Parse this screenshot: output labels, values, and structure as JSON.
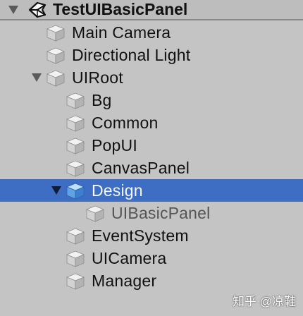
{
  "scene": {
    "name": "TestUIBasicPanel",
    "expanded": true,
    "icon": "unity-logo-icon"
  },
  "hierarchy": [
    {
      "label": "Main Camera",
      "depth": 0,
      "expandable": false,
      "selected": false
    },
    {
      "label": "Directional Light",
      "depth": 0,
      "expandable": false,
      "selected": false
    },
    {
      "label": "UIRoot",
      "depth": 0,
      "expandable": true,
      "expanded": true,
      "selected": false
    },
    {
      "label": "Bg",
      "depth": 1,
      "expandable": false,
      "selected": false
    },
    {
      "label": "Common",
      "depth": 1,
      "expandable": false,
      "selected": false
    },
    {
      "label": "PopUI",
      "depth": 1,
      "expandable": false,
      "selected": false
    },
    {
      "label": "CanvasPanel",
      "depth": 1,
      "expandable": false,
      "selected": false
    },
    {
      "label": "Design",
      "depth": 1,
      "expandable": true,
      "expanded": true,
      "selected": true
    },
    {
      "label": "UIBasicPanel",
      "depth": 2,
      "expandable": false,
      "selected": false,
      "inactive": true
    },
    {
      "label": "EventSystem",
      "depth": 1,
      "expandable": false,
      "selected": false
    },
    {
      "label": "UICamera",
      "depth": 1,
      "expandable": false,
      "selected": false
    },
    {
      "label": "Manager",
      "depth": 1,
      "expandable": false,
      "selected": false
    }
  ],
  "watermark": "知乎 @凉鞋",
  "colors": {
    "background": "#c4c4c4",
    "selection": "#3e6ec4"
  }
}
